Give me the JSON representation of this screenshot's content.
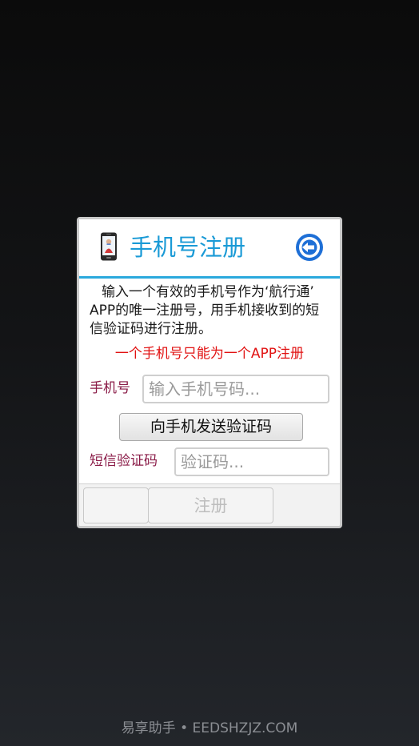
{
  "dialog": {
    "title": "手机号注册",
    "title_icon": "mobile-phone-icon",
    "back_icon": "back-arrow-circle-icon",
    "description": "输入一个有效的手机号作为‘航行通’ APP的唯一注册号，用手机接收到的短信验证码进行注册。",
    "warning": "一个手机号只能为一个APP注册",
    "phone": {
      "label": "手机号",
      "value": "",
      "placeholder": "输入手机号码..."
    },
    "send_code_button": "向手机发送验证码",
    "code": {
      "label": "短信验证码",
      "value": "",
      "placeholder": "验证码..."
    },
    "register_button": "注册"
  },
  "watermark": "易享助手 • EEDSHZJZ.COM",
  "colors": {
    "accent": "#1a9ad6",
    "header_line": "#2aa9dd",
    "label": "#8a1b47",
    "warning": "#e11212"
  }
}
